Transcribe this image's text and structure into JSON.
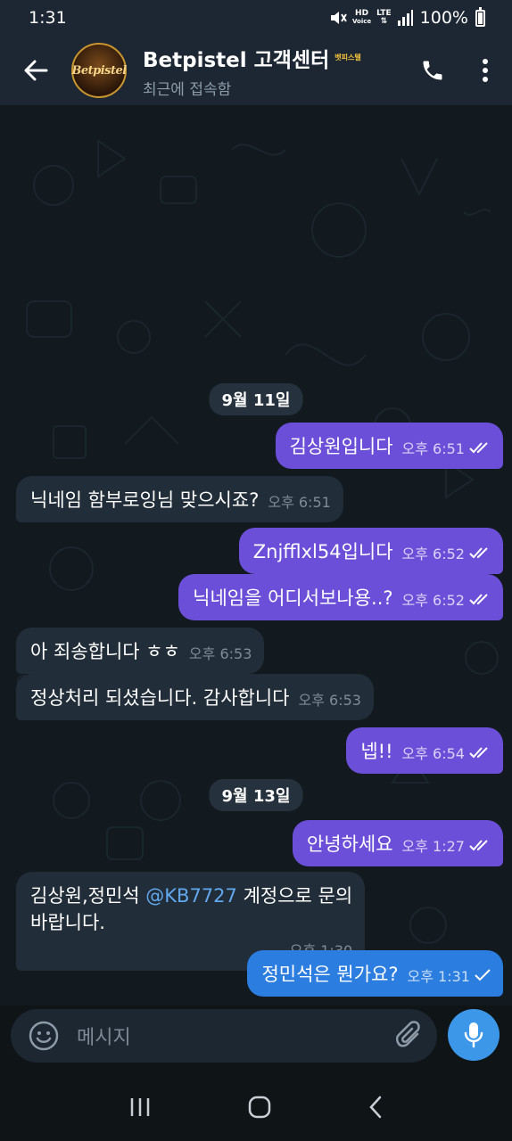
{
  "status": {
    "time": "1:31",
    "hd_top": "HD",
    "hd_bottom": "Voice",
    "lte": "LTE",
    "battery": "100%"
  },
  "header": {
    "title": "Betpistel 고객센터",
    "badge": "벳피스텔",
    "subtitle": "최근에 접속함",
    "avatar_text": "Betpistel"
  },
  "messages": [
    {
      "type": "date",
      "text": "9월 11일"
    },
    {
      "dir": "out",
      "text": "김상원입니다",
      "time": "오후 6:51",
      "read": true
    },
    {
      "dir": "in",
      "text": "닉네임 함부로잉님 맞으시죠?",
      "time": "오후 6:51"
    },
    {
      "dir": "out",
      "text": "Znjfflxl54입니다",
      "time": "오후 6:52",
      "read": true
    },
    {
      "dir": "out",
      "text": "닉네임을 어디서보나용..?",
      "time": "오후 6:52",
      "read": true
    },
    {
      "dir": "in",
      "text": "아 죄송합니다 ㅎㅎ",
      "time": "오후 6:53"
    },
    {
      "dir": "in",
      "text": "정상처리 되셨습니다. 감사합니다",
      "time": "오후 6:53"
    },
    {
      "dir": "out",
      "text": "넵!!",
      "time": "오후 6:54",
      "read": true
    },
    {
      "type": "date",
      "text": "9월 13일"
    },
    {
      "dir": "out",
      "text": "안녕하세요",
      "time": "오후 1:27",
      "read": true
    },
    {
      "dir": "in",
      "text_before": "김상원,정민석 ",
      "mention": "@KB7727",
      "text_after": " 계정으로 문의",
      "text_line2": "바랍니다.",
      "time": "오후 1:30"
    },
    {
      "dir": "out",
      "text": "정민석은 뭔가요?",
      "time": "오후 1:31",
      "read": false
    }
  ],
  "input": {
    "placeholder": "메시지"
  },
  "colors": {
    "outgoing_bubble": "#6c4fd8",
    "outgoing_latest": "#2b7de0",
    "incoming_bubble": "#212d38",
    "header_bg": "#1c2733",
    "mention": "#62a8ef"
  }
}
